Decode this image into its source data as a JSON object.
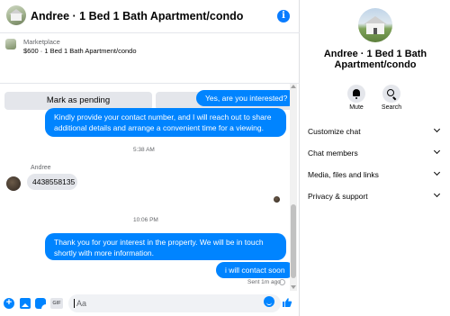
{
  "header": {
    "title": "Andree · 1 Bed 1 Bath Apartment/condo",
    "info_glyph": "i"
  },
  "listing": {
    "source": "Marketplace",
    "price_title": "$600 · 1 Bed 1 Bath Apartment/condo",
    "mark_pending": "Mark as pending",
    "more_options": "More options"
  },
  "messages": {
    "m1": "Yes, are you interested?",
    "m2": "Kindly provide your contact number, and I will reach out to share additional details and arrange a convenient time for a viewing.",
    "time1": "5:38 AM",
    "sender": "Andree",
    "m3": "4438558135",
    "time2": "10:06 PM",
    "m4": "Thank you for your interest in the property. We will be in touch shortly with more information.",
    "m5": "i will contact soon",
    "status": "Sent 1m ago"
  },
  "composer": {
    "placeholder": "Aa",
    "plus_glyph": "+",
    "gif_label": "GIF"
  },
  "panel": {
    "name": "Andree · 1 Bed 1 Bath Apartment/condo",
    "actions": {
      "mute": "Mute",
      "search": "Search"
    },
    "sections": [
      "Customize chat",
      "Chat members",
      "Media, files and links",
      "Privacy & support"
    ]
  },
  "colors": {
    "accent": "#0084ff",
    "bubble_in": "#e4e6eb",
    "muted_text": "#65676b"
  }
}
